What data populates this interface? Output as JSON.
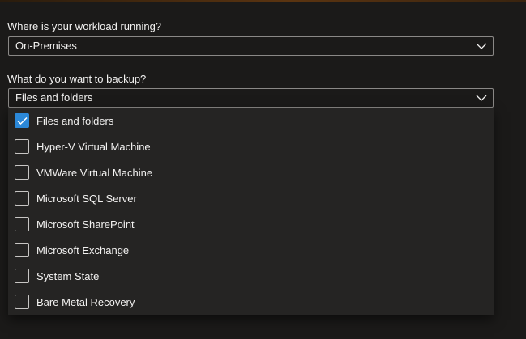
{
  "workload": {
    "label": "Where is your workload running?",
    "selected": "On-Premises"
  },
  "backup": {
    "label": "What do you want to backup?",
    "selected": "Files and folders",
    "options": [
      {
        "label": "Files and folders",
        "checked": true
      },
      {
        "label": "Hyper-V Virtual Machine",
        "checked": false
      },
      {
        "label": "VMWare Virtual Machine",
        "checked": false
      },
      {
        "label": "Microsoft SQL Server",
        "checked": false
      },
      {
        "label": "Microsoft SharePoint",
        "checked": false
      },
      {
        "label": "Microsoft Exchange",
        "checked": false
      },
      {
        "label": "System State",
        "checked": false
      },
      {
        "label": "Bare Metal Recovery",
        "checked": false
      }
    ]
  },
  "icons": {
    "chevron": "chevron-down-icon",
    "check": "checkmark-icon"
  },
  "colors": {
    "accent": "#2b88d8",
    "background": "#1b1a19",
    "panel": "#252423"
  }
}
